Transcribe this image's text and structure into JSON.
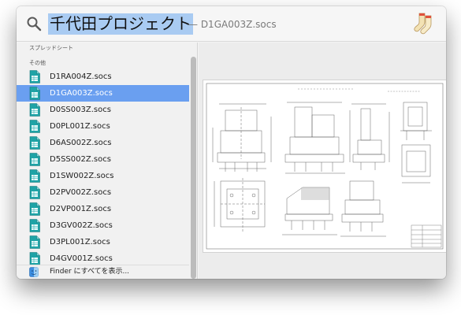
{
  "search": {
    "query": "千代田プロジェクト",
    "suffix": "— D1GA003Z.socs",
    "app_icon": "socks-icon"
  },
  "results": {
    "section_spreadsheet": "スプレッドシート",
    "section_other": "その他",
    "items": [
      {
        "label": "D1RA004Z.socs",
        "selected": false
      },
      {
        "label": "D1GA003Z.socs",
        "selected": true
      },
      {
        "label": "D0SS003Z.socs",
        "selected": false
      },
      {
        "label": "D0PL001Z.socs",
        "selected": false
      },
      {
        "label": "D6AS002Z.socs",
        "selected": false
      },
      {
        "label": "D5SS002Z.socs",
        "selected": false
      },
      {
        "label": "D1SW002Z.socs",
        "selected": false
      },
      {
        "label": "D2PV002Z.socs",
        "selected": false
      },
      {
        "label": "D2VP001Z.socs",
        "selected": false
      },
      {
        "label": "D3GV002Z.socs",
        "selected": false
      },
      {
        "label": "D3PL001Z.socs",
        "selected": false
      },
      {
        "label": "D4GV001Z.socs",
        "selected": false
      }
    ],
    "finder_label": "Finder にすべてを表示..."
  },
  "preview": {
    "document_icon": "cad-drawing-preview"
  },
  "colors": {
    "selection": "#6a9ff0",
    "query_highlight": "#a9cbf2",
    "file_icon": "#1fa3a6"
  }
}
